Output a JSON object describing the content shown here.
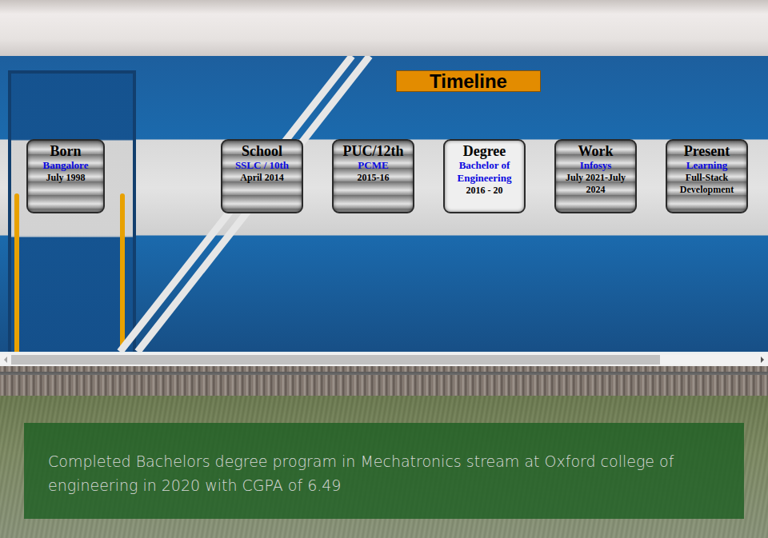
{
  "page": {
    "title": "Timeline"
  },
  "timeline": [
    {
      "title": "Born",
      "subtitle": "Bangalore",
      "detail": "July 1998",
      "selected": false
    },
    {
      "title": "School",
      "subtitle": "SSLC / 10th",
      "detail": "April 2014",
      "selected": false
    },
    {
      "title": "PUC/12th",
      "subtitle": "PCME",
      "detail": "2015-16",
      "selected": false
    },
    {
      "title": "Degree",
      "subtitle": "Bachelor of Engineering",
      "detail": "2016 - 20",
      "selected": true
    },
    {
      "title": "Work",
      "subtitle": "Infosys",
      "detail": "July 2021-July 2024",
      "selected": false
    },
    {
      "title": "Present",
      "subtitle": "Learning",
      "detail": "Full-Stack Development",
      "selected": false
    }
  ],
  "scrollbar": {
    "level": 0.87
  },
  "description": "Completed Bachelors degree program in Mechatronics stream at Oxford college of engineering in 2020 with CGPA of 6.49"
}
